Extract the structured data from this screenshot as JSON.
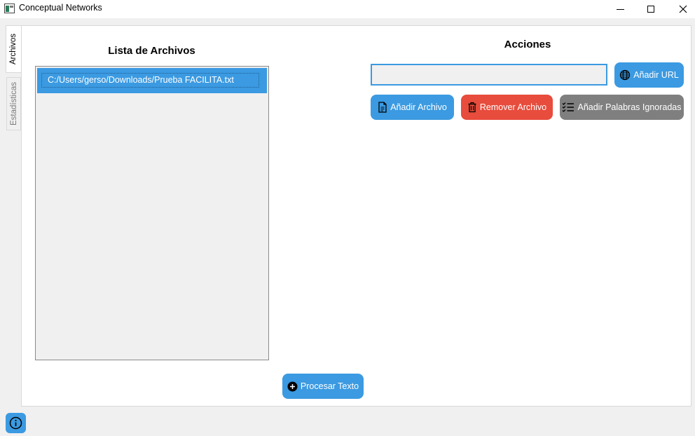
{
  "window": {
    "title": "Conceptual Networks",
    "minimize_icon": "minimize-icon",
    "maximize_icon": "maximize-icon",
    "close_label": "✕"
  },
  "tabs": [
    {
      "label": "Archivos",
      "active": true
    },
    {
      "label": "Estadísticas",
      "active": false
    }
  ],
  "files_panel": {
    "title": "Lista de Archivos",
    "items": [
      "C:/Users/gerso/Downloads/Prueba FACILITA.txt"
    ]
  },
  "actions_panel": {
    "title": "Acciones",
    "url_input": {
      "value": "",
      "placeholder": ""
    },
    "buttons": {
      "add_url": "Añadir URL",
      "add_file": "Añadir Archivo",
      "remove_file": "Remover Archivo",
      "add_ignored_words": "Añadir Palabras Ignoradas"
    }
  },
  "process_button": "Procesar Texto",
  "colors": {
    "accent_blue": "#3b9ae1",
    "danger_red": "#e74c3c",
    "neutral_gray": "#7f7f7f"
  },
  "icons": {
    "app": "app-icon",
    "url": "globe-icon",
    "add_file": "document-icon",
    "remove_file": "trash-icon",
    "ignored_words": "checklist-icon",
    "process": "plus-circle-icon",
    "info": "info-icon"
  }
}
